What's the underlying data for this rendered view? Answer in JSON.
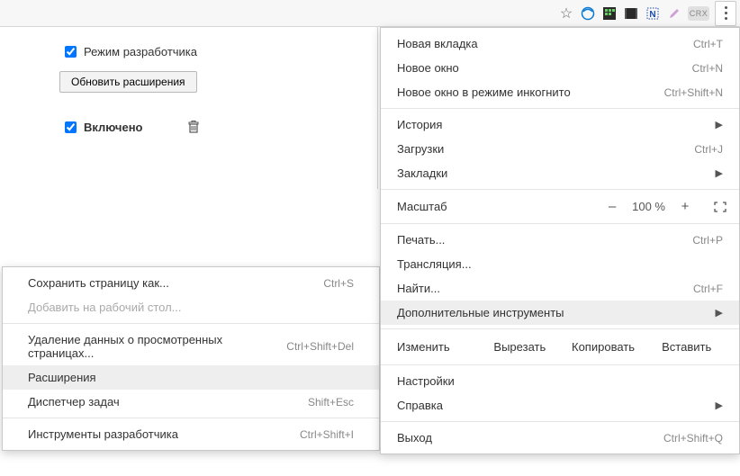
{
  "toolbar": {
    "crx_label": "CRX",
    "star_char": "☆"
  },
  "ext_page": {
    "dev_mode_label": "Режим разработчика",
    "update_btn": "Обновить расширения",
    "enabled_label": "Включено"
  },
  "menu": {
    "new_tab": {
      "label": "Новая вкладка",
      "shortcut": "Ctrl+T"
    },
    "new_window": {
      "label": "Новое окно",
      "shortcut": "Ctrl+N"
    },
    "incognito": {
      "label": "Новое окно в режиме инкогнито",
      "shortcut": "Ctrl+Shift+N"
    },
    "history": {
      "label": "История"
    },
    "downloads": {
      "label": "Загрузки",
      "shortcut": "Ctrl+J"
    },
    "bookmarks": {
      "label": "Закладки"
    },
    "zoom": {
      "label": "Масштаб",
      "percent": "100 %",
      "minus": "–",
      "plus": "+"
    },
    "print": {
      "label": "Печать...",
      "shortcut": "Ctrl+P"
    },
    "cast": {
      "label": "Трансляция..."
    },
    "find": {
      "label": "Найти...",
      "shortcut": "Ctrl+F"
    },
    "more_tools": {
      "label": "Дополнительные инструменты"
    },
    "edit": {
      "label": "Изменить",
      "cut": "Вырезать",
      "copy": "Копировать",
      "paste": "Вставить"
    },
    "settings": {
      "label": "Настройки"
    },
    "help": {
      "label": "Справка"
    },
    "exit": {
      "label": "Выход",
      "shortcut": "Ctrl+Shift+Q"
    }
  },
  "submenu": {
    "save_page": {
      "label": "Сохранить страницу как...",
      "shortcut": "Ctrl+S"
    },
    "add_desktop": {
      "label": "Добавить на рабочий стол..."
    },
    "clear_browsing": {
      "label": "Удаление данных о просмотренных страницах...",
      "shortcut": "Ctrl+Shift+Del"
    },
    "extensions": {
      "label": "Расширения"
    },
    "task_manager": {
      "label": "Диспетчер задач",
      "shortcut": "Shift+Esc"
    },
    "dev_tools": {
      "label": "Инструменты разработчика",
      "shortcut": "Ctrl+Shift+I"
    }
  }
}
